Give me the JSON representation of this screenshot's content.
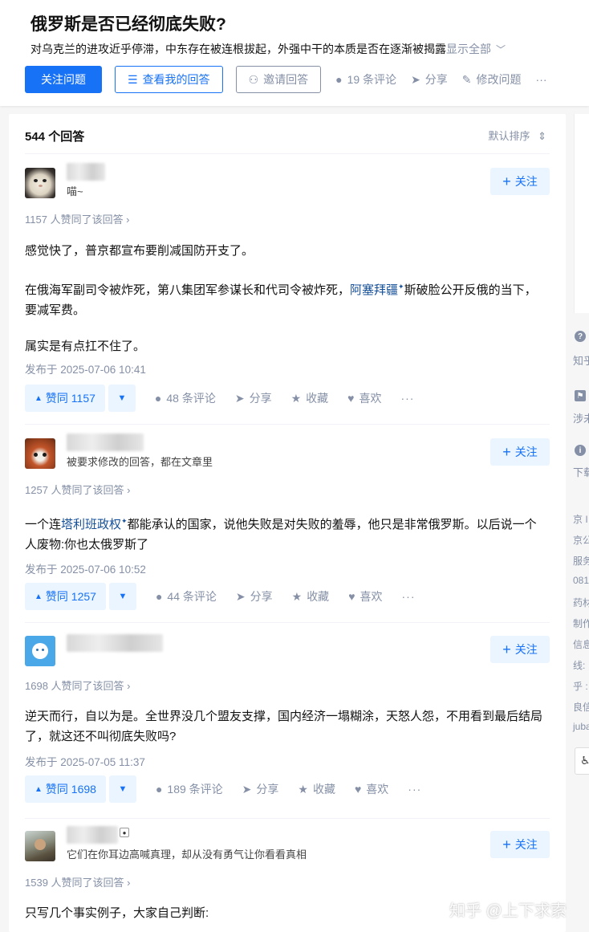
{
  "question": {
    "title": "俄罗斯是否已经彻底失败?",
    "description": "对乌克兰的进攻近乎停滞，中东存在被连根拔起，外强中干的本质是否在逐渐被揭露",
    "show_all": "显示全部",
    "follow_label": "关注问题",
    "my_answer_label": "查看我的回答",
    "invite_label": "邀请回答",
    "comments_label": "19 条评论",
    "share_label": "分享",
    "edit_label": "修改问题",
    "more_label": "···"
  },
  "answers_header": {
    "count_label": "544 个回答",
    "sort_label": "默认排序"
  },
  "follow_label": "关注",
  "actions": {
    "share": "分享",
    "collect": "收藏",
    "like": "喜欢",
    "more": "···"
  },
  "answers": [
    {
      "bio": "喵~",
      "voters": "1157 人赞同了该回答 ›",
      "p1": "感觉快了，普京都宣布要削减国防开支了。",
      "p2a": "在俄海军副司令被炸死，第八集团军参谋长和代司令被炸死，",
      "p2link": "阿塞拜疆",
      "p2b": "斯破脸公开反俄的当下，",
      "p2c": "要减军费。",
      "p3": "属实是有点扛不住了。",
      "time": "发布于 2025-07-06 10:41",
      "vote": "赞同 1157",
      "comments": "48 条评论"
    },
    {
      "bio": "被要求修改的回答，都在文章里",
      "voters": "1257 人赞同了该回答 ›",
      "p1a": "一个连",
      "p1link": "塔利班政权",
      "p1b": "都能承认的国家，说他失败是对失败的羞辱，他只是非常俄罗斯。以后说一个",
      "p1c": "人废物:你也太俄罗斯了",
      "time": "发布于 2025-07-06 10:52",
      "vote": "赞同 1257",
      "comments": "44 条评论"
    },
    {
      "bio": "",
      "voters": "1698 人赞同了该回答 ›",
      "p1": "逆天而行，自以为是。全世界没几个盟友支撑，国内经济一塌糊涂，天怒人怨，不用看到最后结局",
      "p1c": "了，就这还不叫彻底失败吗?",
      "time": "发布于 2025-07-05 11:37",
      "vote": "赞同 1698",
      "comments": "189 条评论"
    },
    {
      "bio": "它们在你耳边高喊真理，却从没有勇气让你看看真相",
      "voters": "1539 人赞同了该回答 ›",
      "p1": "只写几个事实例子，大家自己判断:"
    }
  ],
  "sidebar": {
    "t1": "知乎",
    "t2": "涉未",
    "t3": "下载",
    "info": [
      "京 I",
      "京公",
      "服务",
      "081",
      "药材",
      "制作",
      "信息",
      "线:",
      "乎 :",
      "良信",
      "juba"
    ]
  },
  "watermark": "知乎 @上下求索",
  "colors": {
    "brand": "#1772f6",
    "muted": "#8590a6",
    "link": "#175199"
  }
}
